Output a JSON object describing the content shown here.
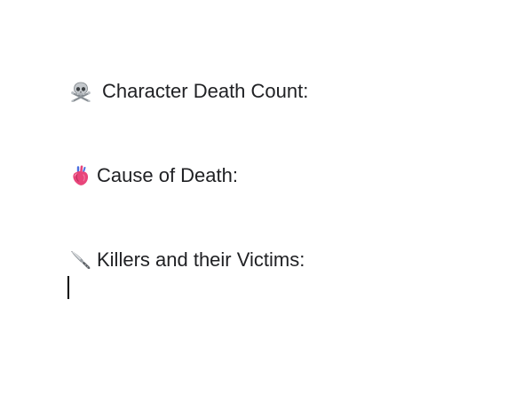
{
  "document": {
    "lines": [
      {
        "icon": "skull-and-crossbones-icon",
        "text": "Character Death Count:"
      },
      {
        "icon": "anatomical-heart-icon",
        "text": "Cause of Death:"
      },
      {
        "icon": "kitchen-knife-icon",
        "text": "Killers and their Victims:"
      }
    ]
  },
  "colors": {
    "text": "#202124",
    "caret": "#000000",
    "heart": "#e8457a",
    "skull": "#9aa0a6"
  }
}
